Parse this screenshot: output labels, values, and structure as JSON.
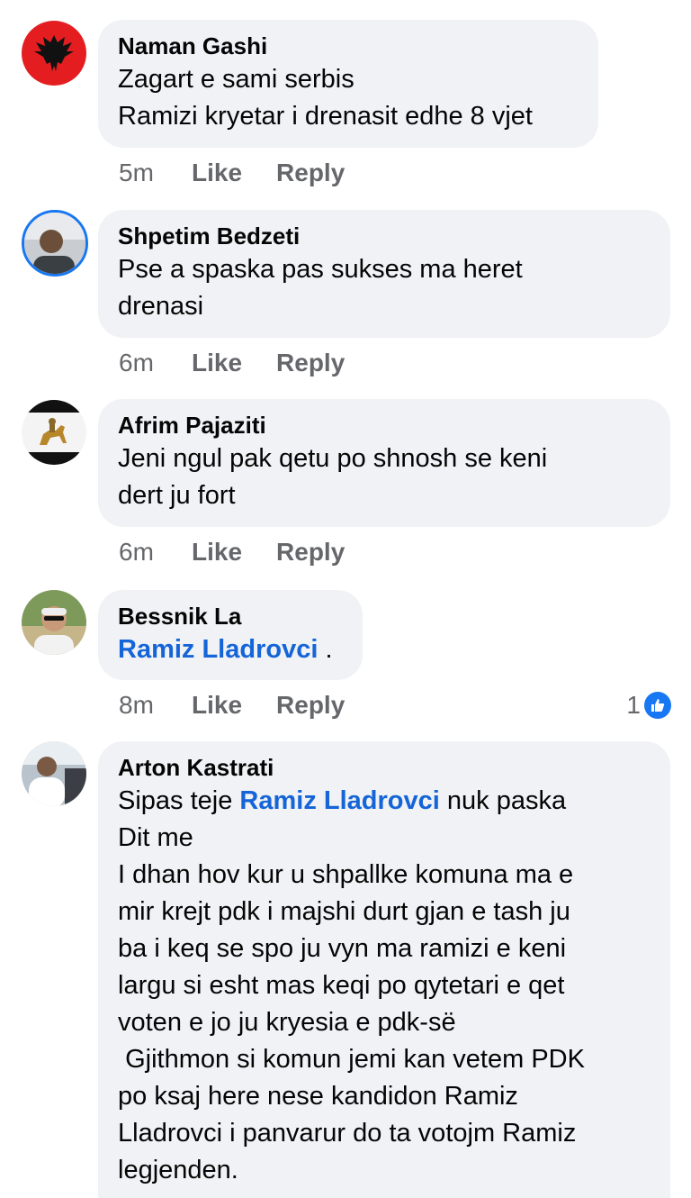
{
  "comments": [
    {
      "author": "Naman Gashi",
      "avatar_icon": "albanian-flag-eagle",
      "lines": [
        "Zagart e sami serbis",
        "Ramizi kryetar i drenasit edhe 8 vjet"
      ],
      "time": "5m",
      "like": "Like",
      "reply": "Reply"
    },
    {
      "author": "Shpetim Bedzeti",
      "avatar_icon": "profile-photo",
      "lines": [
        "Pse a spaska pas sukses ma heret",
        "drenasi"
      ],
      "time": "6m",
      "like": "Like",
      "reply": "Reply"
    },
    {
      "author": "Afrim Pajaziti",
      "avatar_icon": "horse-rider-statue",
      "lines": [
        "Jeni ngul pak qetu po shnosh se keni",
        "dert ju fort"
      ],
      "time": "6m",
      "like": "Like",
      "reply": "Reply"
    },
    {
      "author": "Bessnik La",
      "avatar_icon": "profile-photo",
      "mention": "Ramiz Lladrovci",
      "after_mention": " .",
      "time": "8m",
      "like": "Like",
      "reply": "Reply",
      "reaction_count": "1"
    },
    {
      "author": "Arton Kastrati",
      "avatar_icon": "profile-photo-car",
      "first_prefix": "Sipas teje ",
      "mention": "Ramiz Lladrovci",
      "first_suffix": " nuk paska",
      "lines": [
        "Dit me",
        "I dhan hov kur u shpallke komuna ma e",
        "mir krejt pdk i majshi durt gjan e tash ju",
        "ba i keq se spo ju vyn ma ramizi e keni",
        "largu si esht mas keqi po qytetari e qet",
        "voten e jo ju kryesia e pdk-së",
        " Gjithmon si komun jemi kan vetem PDK",
        "po ksaj here nese kandidon Ramiz",
        "Lladrovci i panvarur do ta votojm Ramiz",
        "legjenden."
      ]
    }
  ],
  "colors": {
    "bubble": "#f0f2f5",
    "mention": "#1565d8",
    "meta": "#65676b",
    "like_badge": "#1877f2"
  }
}
